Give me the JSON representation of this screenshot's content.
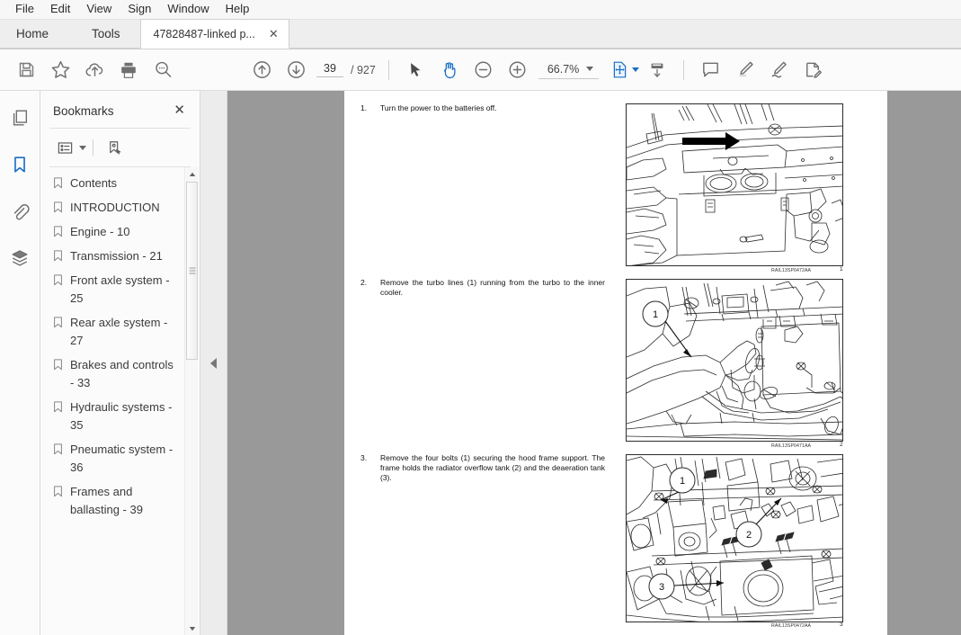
{
  "menubar": {
    "items": [
      "File",
      "Edit",
      "View",
      "Sign",
      "Window",
      "Help"
    ]
  },
  "tabbar": {
    "home": "Home",
    "tools": "Tools",
    "document_tab": "47828487-linked p...",
    "close_glyph": "✕"
  },
  "toolbar": {
    "icons": [
      "save-icon",
      "star-icon",
      "upload-cloud-icon",
      "print-icon",
      "search-icon",
      "previous-page-icon",
      "next-page-icon"
    ],
    "page_current": "39",
    "page_total": "/ 927",
    "zoom_value": "66.7%",
    "right_icons": [
      "select-cursor-icon",
      "hand-tool-icon",
      "zoom-out-icon",
      "zoom-in-icon",
      "fit-page-icon",
      "scroll-mode-icon",
      "comment-icon",
      "highlight-icon",
      "sign-icon",
      "fill-and-sign-icon"
    ]
  },
  "rail": {
    "items": [
      {
        "name": "page-thumbnails-icon",
        "active": false
      },
      {
        "name": "bookmarks-icon",
        "active": true
      },
      {
        "name": "attachments-icon",
        "active": false
      },
      {
        "name": "layers-icon",
        "active": false
      }
    ]
  },
  "bookmarks": {
    "title": "Bookmarks",
    "close_glyph": "✕",
    "tools": [
      "options-list-icon",
      "new-bookmark-icon"
    ],
    "items": [
      "Contents",
      "INTRODUCTION",
      "Engine - 10",
      "Transmission - 21",
      "Front axle system - 25",
      "Rear axle system - 27",
      "Brakes and controls - 33",
      "Hydraulic systems - 35",
      "Pneumatic system - 36",
      "Frames and ballasting - 39"
    ]
  },
  "document": {
    "steps": [
      {
        "num": "1.",
        "text": "Turn the power to the batteries off."
      },
      {
        "num": "2.",
        "text": "Remove the turbo lines (1) running from the turbo to the inner cooler."
      },
      {
        "num": "3.",
        "text": "Remove the four bolts (1) securing the hood frame support.  The frame holds the radiator overflow tank (2) and the deaeration tank (3)."
      }
    ],
    "figures": [
      {
        "caption": "RAIL13SP0472AA",
        "number": "1"
      },
      {
        "caption": "RAIL13SP0471AA",
        "number": "2"
      },
      {
        "caption": "RAIL13SP0472AA",
        "number": "3"
      }
    ]
  },
  "colors": {
    "accent": "#1a6fc4",
    "viewer_bg": "#999999",
    "panel_bg": "#fbfbfb"
  }
}
